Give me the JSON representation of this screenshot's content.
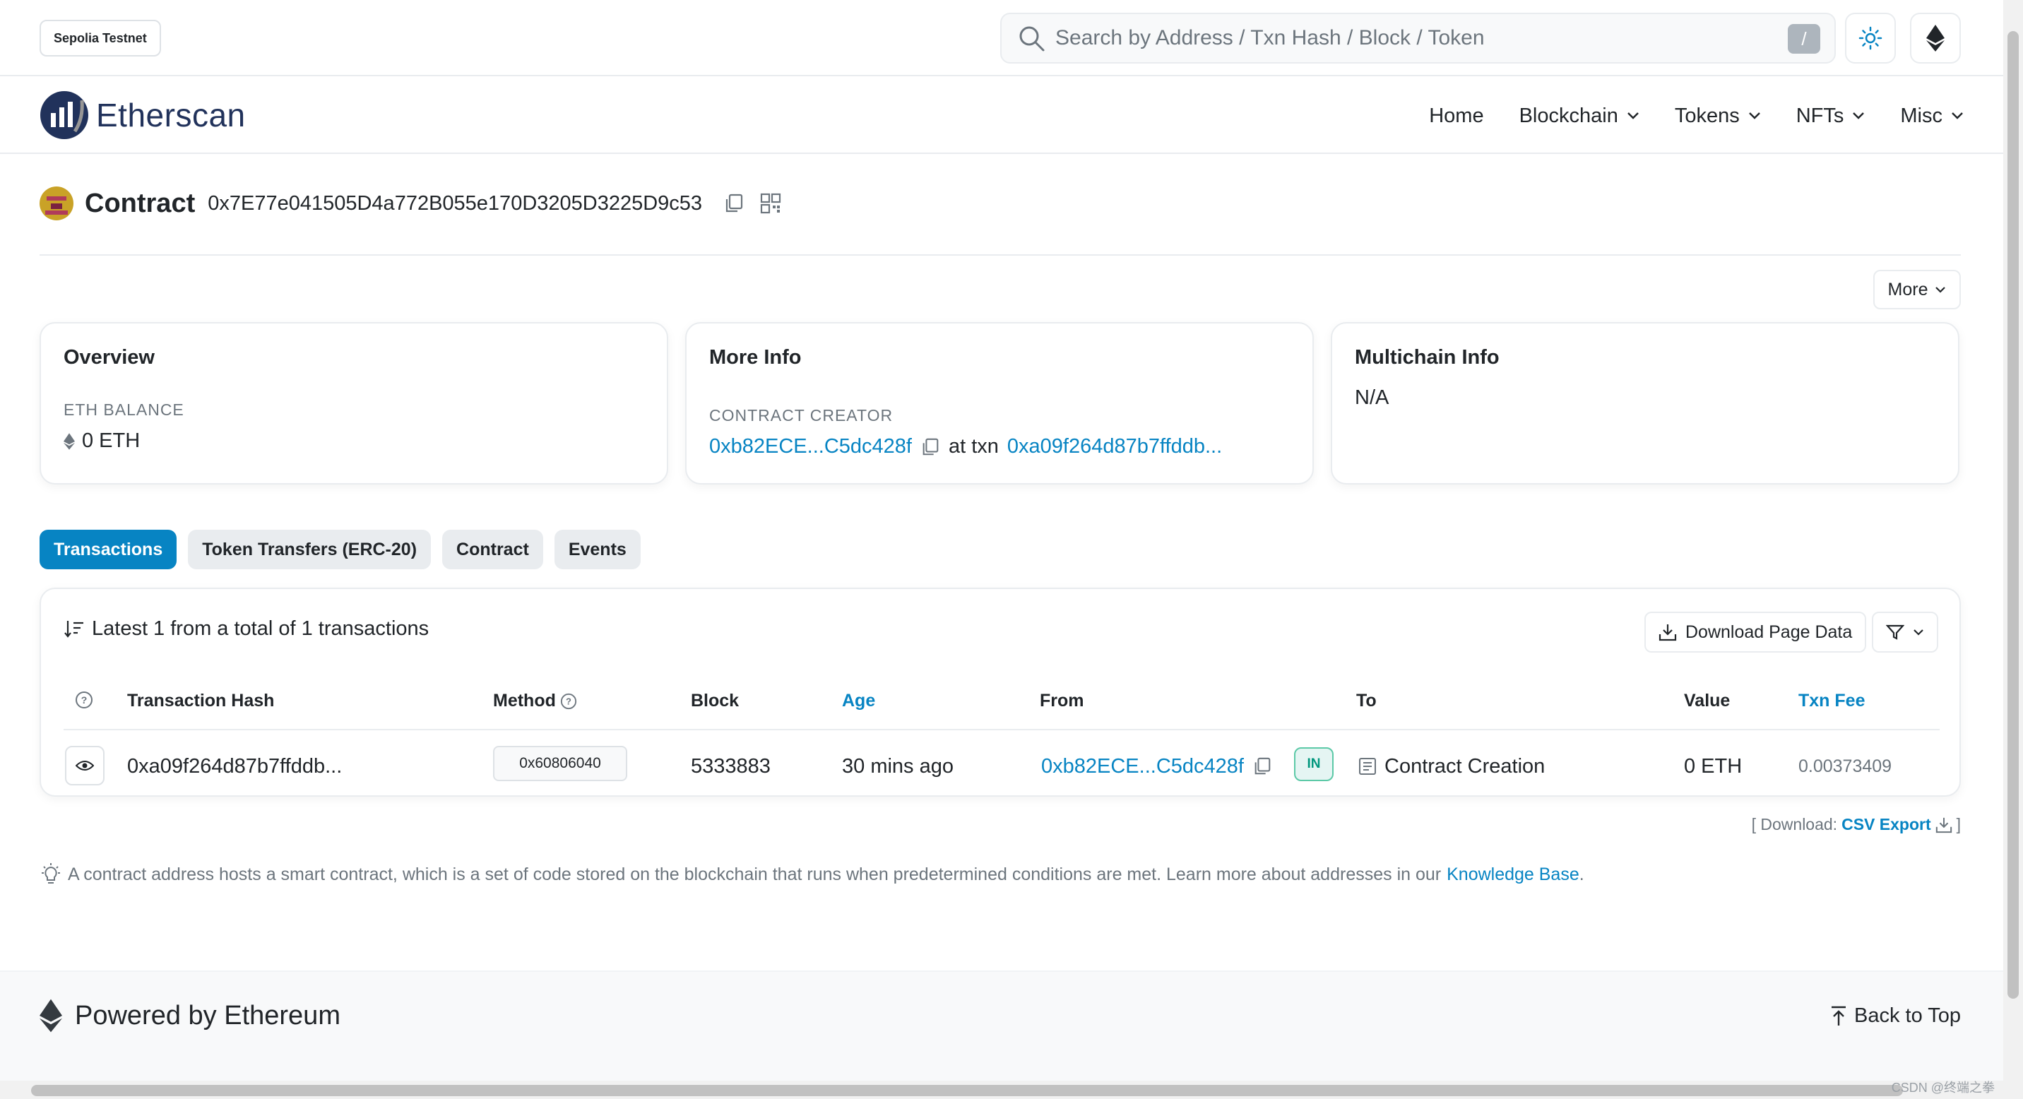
{
  "topbar": {
    "network": "Sepolia Testnet",
    "search_placeholder": "Search by Address / Txn Hash / Block / Token",
    "search_shortcut": "/"
  },
  "nav": {
    "logo": "Etherscan",
    "items": [
      {
        "label": "Home",
        "dropdown": false
      },
      {
        "label": "Blockchain",
        "dropdown": true
      },
      {
        "label": "Tokens",
        "dropdown": true
      },
      {
        "label": "NFTs",
        "dropdown": true
      },
      {
        "label": "Misc",
        "dropdown": true
      }
    ]
  },
  "contract": {
    "title": "Contract",
    "address": "0x7E77e041505D4a772B055e170D3205D3225D9c53"
  },
  "more_button": "More",
  "cards": {
    "overview": {
      "title": "Overview",
      "label": "ETH BALANCE",
      "value": "0 ETH"
    },
    "more_info": {
      "title": "More Info",
      "label": "CONTRACT CREATOR",
      "creator": "0xb82ECE...C5dc428f",
      "at_txn": "at txn",
      "txn": "0xa09f264d87b7ffddb..."
    },
    "multichain": {
      "title": "Multichain Info",
      "value": "N/A"
    }
  },
  "tabs": [
    "Transactions",
    "Token Transfers (ERC-20)",
    "Contract",
    "Events"
  ],
  "table": {
    "summary": "Latest 1 from a total of 1 transactions",
    "download_button": "Download Page Data",
    "headers": {
      "hash": "Transaction Hash",
      "method": "Method",
      "block": "Block",
      "age": "Age",
      "from": "From",
      "to": "To",
      "value": "Value",
      "fee": "Txn Fee"
    },
    "rows": [
      {
        "hash": "0xa09f264d87b7ffddb...",
        "method": "0x60806040",
        "block": "5333883",
        "age": "30 mins ago",
        "from": "0xb82ECE...C5dc428f",
        "direction": "IN",
        "to": "Contract Creation",
        "value": "0 ETH",
        "fee": "0.00373409"
      }
    ]
  },
  "download": {
    "prefix": "[ Download:",
    "link": "CSV Export",
    "suffix": "]"
  },
  "info": {
    "text": "A contract address hosts a smart contract, which is a set of code stored on the blockchain that runs when predetermined conditions are met. Learn more about addresses in our",
    "link": "Knowledge Base",
    "end": "."
  },
  "footer": {
    "brand": "Powered by Ethereum",
    "back_to_top": "Back to Top"
  },
  "watermark": "CSDN @终端之拳",
  "colors": {
    "link": "#0784c3",
    "active_tab": "#0784c3",
    "in_badge": "#02977e",
    "logo": "#21325b"
  }
}
